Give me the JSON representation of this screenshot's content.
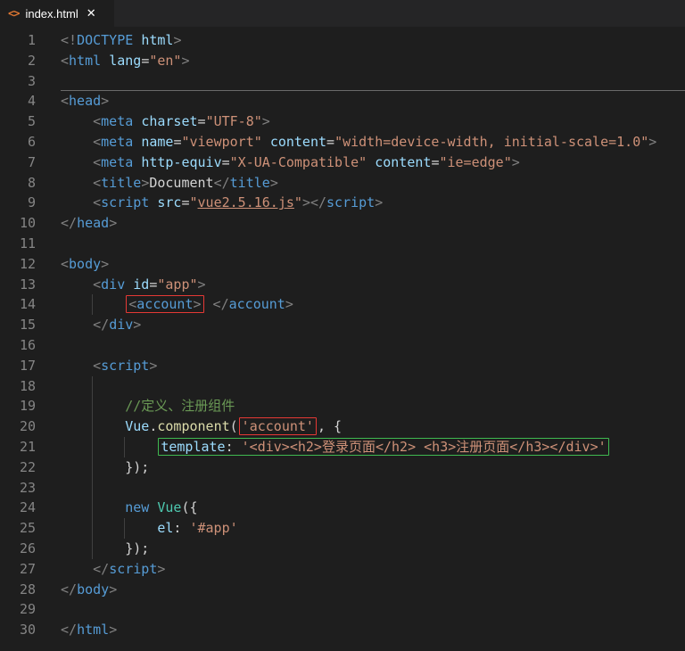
{
  "tab_bar": {
    "tab": {
      "icon_glyph": "<>",
      "title": "index.html",
      "close_glyph": "✕"
    }
  },
  "colors": {
    "background": "#1e1e1e",
    "tab_bar_background": "#252526",
    "tab_title": "#ffffff",
    "file_icon": "#e37933",
    "line_number": "#858585",
    "indent_guide": "#404040",
    "hr_line": "#6a6a6a",
    "punctuation": "#808080",
    "tag": "#569cd6",
    "attribute": "#9cdcfe",
    "string": "#ce9178",
    "text": "#d4d4d4",
    "comment": "#6a9955",
    "keyword": "#569cd6",
    "function": "#dcdcaa",
    "class": "#4ec9b0",
    "accent_red_box": "#e53935",
    "accent_green_box": "#3fb950"
  },
  "editor": {
    "lines": [
      {
        "n": "1",
        "tokens": [
          {
            "t": "<!",
            "c": "p"
          },
          {
            "t": "DOCTYPE",
            "c": "tag"
          },
          {
            "t": " ",
            "c": "txt"
          },
          {
            "t": "html",
            "c": "attr"
          },
          {
            "t": ">",
            "c": "p"
          }
        ]
      },
      {
        "n": "2",
        "tokens": [
          {
            "t": "<",
            "c": "p"
          },
          {
            "t": "html",
            "c": "tag"
          },
          {
            "t": " ",
            "c": "txt"
          },
          {
            "t": "lang",
            "c": "attr"
          },
          {
            "t": "=",
            "c": "txt"
          },
          {
            "t": "\"en\"",
            "c": "str"
          },
          {
            "t": ">",
            "c": "p"
          }
        ]
      },
      {
        "n": "3",
        "hr": true,
        "tokens": []
      },
      {
        "n": "4",
        "tokens": [
          {
            "t": "<",
            "c": "p"
          },
          {
            "t": "head",
            "c": "tag"
          },
          {
            "t": ">",
            "c": "p"
          }
        ]
      },
      {
        "n": "5",
        "pad": 4,
        "tokens": [
          {
            "t": "<",
            "c": "p"
          },
          {
            "t": "meta",
            "c": "tag"
          },
          {
            "t": " ",
            "c": "txt"
          },
          {
            "t": "charset",
            "c": "attr"
          },
          {
            "t": "=",
            "c": "txt"
          },
          {
            "t": "\"UTF-8\"",
            "c": "str"
          },
          {
            "t": ">",
            "c": "p"
          }
        ]
      },
      {
        "n": "6",
        "pad": 4,
        "tokens": [
          {
            "t": "<",
            "c": "p"
          },
          {
            "t": "meta",
            "c": "tag"
          },
          {
            "t": " ",
            "c": "txt"
          },
          {
            "t": "name",
            "c": "attr"
          },
          {
            "t": "=",
            "c": "txt"
          },
          {
            "t": "\"viewport\"",
            "c": "str"
          },
          {
            "t": " ",
            "c": "txt"
          },
          {
            "t": "content",
            "c": "attr"
          },
          {
            "t": "=",
            "c": "txt"
          },
          {
            "t": "\"width=device-width, initial-scale=1.0\"",
            "c": "str"
          },
          {
            "t": ">",
            "c": "p"
          }
        ]
      },
      {
        "n": "7",
        "pad": 4,
        "tokens": [
          {
            "t": "<",
            "c": "p"
          },
          {
            "t": "meta",
            "c": "tag"
          },
          {
            "t": " ",
            "c": "txt"
          },
          {
            "t": "http-equiv",
            "c": "attr"
          },
          {
            "t": "=",
            "c": "txt"
          },
          {
            "t": "\"X-UA-Compatible\"",
            "c": "str"
          },
          {
            "t": " ",
            "c": "txt"
          },
          {
            "t": "content",
            "c": "attr"
          },
          {
            "t": "=",
            "c": "txt"
          },
          {
            "t": "\"ie=edge\"",
            "c": "str"
          },
          {
            "t": ">",
            "c": "p"
          }
        ]
      },
      {
        "n": "8",
        "pad": 4,
        "tokens": [
          {
            "t": "<",
            "c": "p"
          },
          {
            "t": "title",
            "c": "tag"
          },
          {
            "t": ">",
            "c": "p"
          },
          {
            "t": "Document",
            "c": "txt"
          },
          {
            "t": "</",
            "c": "p"
          },
          {
            "t": "title",
            "c": "tag"
          },
          {
            "t": ">",
            "c": "p"
          }
        ]
      },
      {
        "n": "9",
        "pad": 4,
        "tokens": [
          {
            "t": "<",
            "c": "p"
          },
          {
            "t": "script",
            "c": "tag"
          },
          {
            "t": " ",
            "c": "txt"
          },
          {
            "t": "src",
            "c": "attr"
          },
          {
            "t": "=",
            "c": "txt"
          },
          {
            "t": "\"",
            "c": "str"
          },
          {
            "t": "vue2.5.16.js",
            "c": "link"
          },
          {
            "t": "\"",
            "c": "str"
          },
          {
            "t": ">",
            "c": "p"
          },
          {
            "t": "</",
            "c": "p"
          },
          {
            "t": "script",
            "c": "tag"
          },
          {
            "t": ">",
            "c": "p"
          }
        ]
      },
      {
        "n": "10",
        "tokens": [
          {
            "t": "</",
            "c": "p"
          },
          {
            "t": "head",
            "c": "tag"
          },
          {
            "t": ">",
            "c": "p"
          }
        ]
      },
      {
        "n": "11",
        "tokens": []
      },
      {
        "n": "12",
        "tokens": [
          {
            "t": "<",
            "c": "p"
          },
          {
            "t": "body",
            "c": "tag"
          },
          {
            "t": ">",
            "c": "p"
          }
        ]
      },
      {
        "n": "13",
        "pad": 4,
        "tokens": [
          {
            "t": "<",
            "c": "p"
          },
          {
            "t": "div",
            "c": "tag"
          },
          {
            "t": " ",
            "c": "txt"
          },
          {
            "t": "id",
            "c": "attr"
          },
          {
            "t": "=",
            "c": "txt"
          },
          {
            "t": "\"app\"",
            "c": "str"
          },
          {
            "t": ">",
            "c": "p"
          }
        ]
      },
      {
        "n": "14",
        "guides": 1,
        "pad": 4,
        "tokens": [
          {
            "box": "red",
            "tokens": [
              {
                "t": "<",
                "c": "p"
              },
              {
                "t": "account",
                "c": "tag"
              },
              {
                "t": ">",
                "c": "p"
              }
            ]
          },
          {
            "t": " ",
            "c": "txt"
          },
          {
            "t": "</",
            "c": "p"
          },
          {
            "t": "account",
            "c": "tag"
          },
          {
            "t": ">",
            "c": "p"
          }
        ]
      },
      {
        "n": "15",
        "pad": 4,
        "tokens": [
          {
            "t": "</",
            "c": "p"
          },
          {
            "t": "div",
            "c": "tag"
          },
          {
            "t": ">",
            "c": "p"
          }
        ]
      },
      {
        "n": "16",
        "tokens": []
      },
      {
        "n": "17",
        "pad": 4,
        "tokens": [
          {
            "t": "<",
            "c": "p"
          },
          {
            "t": "script",
            "c": "tag"
          },
          {
            "t": ">",
            "c": "p"
          }
        ]
      },
      {
        "n": "18",
        "guides": 1,
        "tokens": []
      },
      {
        "n": "19",
        "guides": 1,
        "pad": 4,
        "tokens": [
          {
            "t": "//定义、注册组件",
            "c": "cmt"
          }
        ]
      },
      {
        "n": "20",
        "guides": 1,
        "pad": 4,
        "tokens": [
          {
            "t": "Vue",
            "c": "attr"
          },
          {
            "t": ".",
            "c": "txt"
          },
          {
            "t": "component",
            "c": "fn"
          },
          {
            "t": "(",
            "c": "txt"
          },
          {
            "box": "red",
            "tokens": [
              {
                "t": "'account'",
                "c": "str"
              }
            ]
          },
          {
            "t": ", {",
            "c": "txt"
          }
        ]
      },
      {
        "n": "21",
        "guides": 2,
        "pad": 4,
        "tokens": [
          {
            "box": "green",
            "tokens": [
              {
                "t": "template",
                "c": "attr"
              },
              {
                "t": ": ",
                "c": "txt"
              },
              {
                "t": "'<div><h2>登录页面</h2> <h3>注册页面</h3></div>'",
                "c": "str"
              }
            ]
          }
        ]
      },
      {
        "n": "22",
        "guides": 1,
        "pad": 4,
        "tokens": [
          {
            "t": "});",
            "c": "txt"
          }
        ]
      },
      {
        "n": "23",
        "guides": 1,
        "tokens": []
      },
      {
        "n": "24",
        "guides": 1,
        "pad": 4,
        "tokens": [
          {
            "t": "new",
            "c": "kw"
          },
          {
            "t": " ",
            "c": "txt"
          },
          {
            "t": "Vue",
            "c": "cls"
          },
          {
            "t": "({",
            "c": "txt"
          }
        ]
      },
      {
        "n": "25",
        "guides": 2,
        "pad": 4,
        "tokens": [
          {
            "t": "el",
            "c": "attr"
          },
          {
            "t": ": ",
            "c": "txt"
          },
          {
            "t": "'#app'",
            "c": "str"
          }
        ]
      },
      {
        "n": "26",
        "guides": 1,
        "pad": 4,
        "tokens": [
          {
            "t": "});",
            "c": "txt"
          }
        ]
      },
      {
        "n": "27",
        "pad": 4,
        "tokens": [
          {
            "t": "</",
            "c": "p"
          },
          {
            "t": "script",
            "c": "tag"
          },
          {
            "t": ">",
            "c": "p"
          }
        ]
      },
      {
        "n": "28",
        "tokens": [
          {
            "t": "</",
            "c": "p"
          },
          {
            "t": "body",
            "c": "tag"
          },
          {
            "t": ">",
            "c": "p"
          }
        ]
      },
      {
        "n": "29",
        "tokens": []
      },
      {
        "n": "30",
        "tokens": [
          {
            "t": "</",
            "c": "p"
          },
          {
            "t": "html",
            "c": "tag"
          },
          {
            "t": ">",
            "c": "p"
          }
        ]
      }
    ]
  }
}
